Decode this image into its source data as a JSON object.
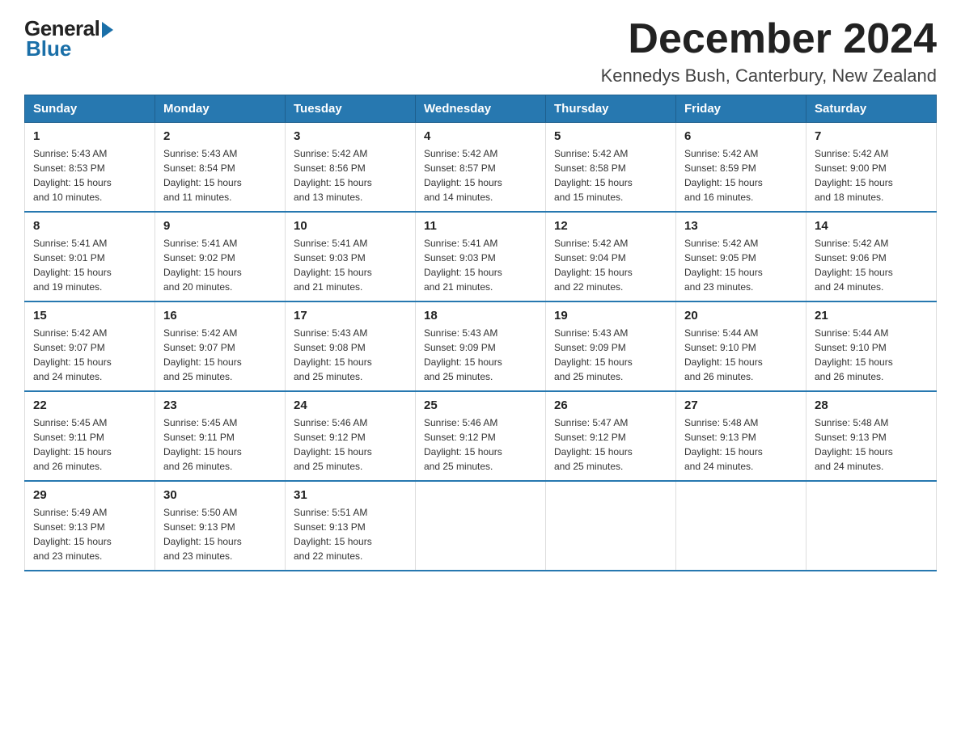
{
  "logo": {
    "general": "General",
    "blue": "Blue"
  },
  "header": {
    "month": "December 2024",
    "location": "Kennedys Bush, Canterbury, New Zealand"
  },
  "weekdays": [
    "Sunday",
    "Monday",
    "Tuesday",
    "Wednesday",
    "Thursday",
    "Friday",
    "Saturday"
  ],
  "weeks": [
    [
      {
        "day": "1",
        "sunrise": "5:43 AM",
        "sunset": "8:53 PM",
        "daylight": "15 hours and 10 minutes."
      },
      {
        "day": "2",
        "sunrise": "5:43 AM",
        "sunset": "8:54 PM",
        "daylight": "15 hours and 11 minutes."
      },
      {
        "day": "3",
        "sunrise": "5:42 AM",
        "sunset": "8:56 PM",
        "daylight": "15 hours and 13 minutes."
      },
      {
        "day": "4",
        "sunrise": "5:42 AM",
        "sunset": "8:57 PM",
        "daylight": "15 hours and 14 minutes."
      },
      {
        "day": "5",
        "sunrise": "5:42 AM",
        "sunset": "8:58 PM",
        "daylight": "15 hours and 15 minutes."
      },
      {
        "day": "6",
        "sunrise": "5:42 AM",
        "sunset": "8:59 PM",
        "daylight": "15 hours and 16 minutes."
      },
      {
        "day": "7",
        "sunrise": "5:42 AM",
        "sunset": "9:00 PM",
        "daylight": "15 hours and 18 minutes."
      }
    ],
    [
      {
        "day": "8",
        "sunrise": "5:41 AM",
        "sunset": "9:01 PM",
        "daylight": "15 hours and 19 minutes."
      },
      {
        "day": "9",
        "sunrise": "5:41 AM",
        "sunset": "9:02 PM",
        "daylight": "15 hours and 20 minutes."
      },
      {
        "day": "10",
        "sunrise": "5:41 AM",
        "sunset": "9:03 PM",
        "daylight": "15 hours and 21 minutes."
      },
      {
        "day": "11",
        "sunrise": "5:41 AM",
        "sunset": "9:03 PM",
        "daylight": "15 hours and 21 minutes."
      },
      {
        "day": "12",
        "sunrise": "5:42 AM",
        "sunset": "9:04 PM",
        "daylight": "15 hours and 22 minutes."
      },
      {
        "day": "13",
        "sunrise": "5:42 AM",
        "sunset": "9:05 PM",
        "daylight": "15 hours and 23 minutes."
      },
      {
        "day": "14",
        "sunrise": "5:42 AM",
        "sunset": "9:06 PM",
        "daylight": "15 hours and 24 minutes."
      }
    ],
    [
      {
        "day": "15",
        "sunrise": "5:42 AM",
        "sunset": "9:07 PM",
        "daylight": "15 hours and 24 minutes."
      },
      {
        "day": "16",
        "sunrise": "5:42 AM",
        "sunset": "9:07 PM",
        "daylight": "15 hours and 25 minutes."
      },
      {
        "day": "17",
        "sunrise": "5:43 AM",
        "sunset": "9:08 PM",
        "daylight": "15 hours and 25 minutes."
      },
      {
        "day": "18",
        "sunrise": "5:43 AM",
        "sunset": "9:09 PM",
        "daylight": "15 hours and 25 minutes."
      },
      {
        "day": "19",
        "sunrise": "5:43 AM",
        "sunset": "9:09 PM",
        "daylight": "15 hours and 25 minutes."
      },
      {
        "day": "20",
        "sunrise": "5:44 AM",
        "sunset": "9:10 PM",
        "daylight": "15 hours and 26 minutes."
      },
      {
        "day": "21",
        "sunrise": "5:44 AM",
        "sunset": "9:10 PM",
        "daylight": "15 hours and 26 minutes."
      }
    ],
    [
      {
        "day": "22",
        "sunrise": "5:45 AM",
        "sunset": "9:11 PM",
        "daylight": "15 hours and 26 minutes."
      },
      {
        "day": "23",
        "sunrise": "5:45 AM",
        "sunset": "9:11 PM",
        "daylight": "15 hours and 26 minutes."
      },
      {
        "day": "24",
        "sunrise": "5:46 AM",
        "sunset": "9:12 PM",
        "daylight": "15 hours and 25 minutes."
      },
      {
        "day": "25",
        "sunrise": "5:46 AM",
        "sunset": "9:12 PM",
        "daylight": "15 hours and 25 minutes."
      },
      {
        "day": "26",
        "sunrise": "5:47 AM",
        "sunset": "9:12 PM",
        "daylight": "15 hours and 25 minutes."
      },
      {
        "day": "27",
        "sunrise": "5:48 AM",
        "sunset": "9:13 PM",
        "daylight": "15 hours and 24 minutes."
      },
      {
        "day": "28",
        "sunrise": "5:48 AM",
        "sunset": "9:13 PM",
        "daylight": "15 hours and 24 minutes."
      }
    ],
    [
      {
        "day": "29",
        "sunrise": "5:49 AM",
        "sunset": "9:13 PM",
        "daylight": "15 hours and 23 minutes."
      },
      {
        "day": "30",
        "sunrise": "5:50 AM",
        "sunset": "9:13 PM",
        "daylight": "15 hours and 23 minutes."
      },
      {
        "day": "31",
        "sunrise": "5:51 AM",
        "sunset": "9:13 PM",
        "daylight": "15 hours and 22 minutes."
      },
      null,
      null,
      null,
      null
    ]
  ],
  "labels": {
    "sunrise": "Sunrise:",
    "sunset": "Sunset:",
    "daylight": "Daylight:"
  }
}
